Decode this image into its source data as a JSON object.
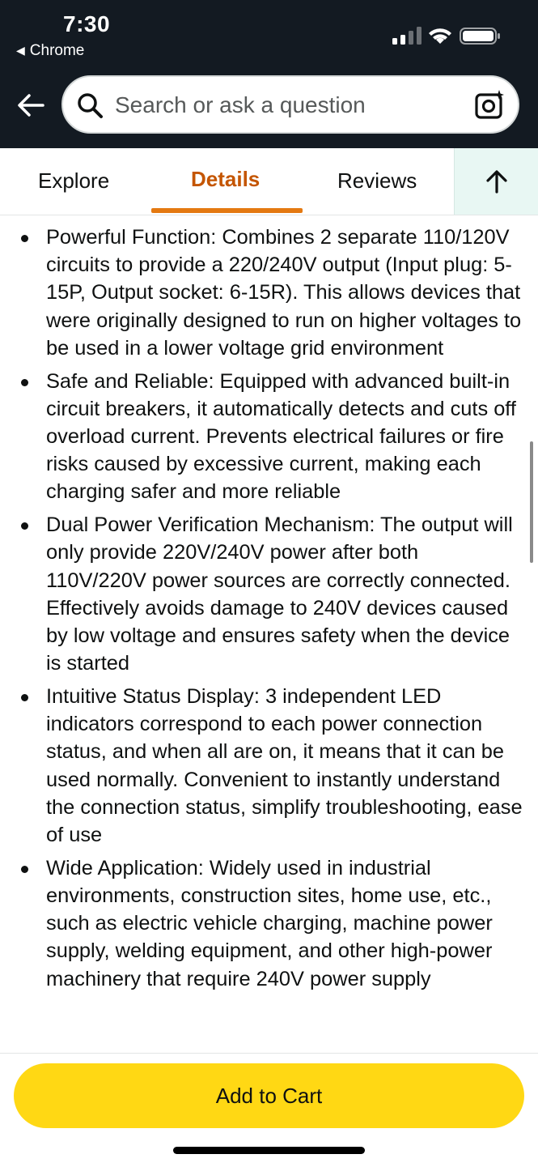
{
  "status_bar": {
    "time": "7:30",
    "back_app": "Chrome",
    "back_app_icon": "triangle-left-icon"
  },
  "header": {
    "back_icon": "arrow-left-icon",
    "search": {
      "placeholder": "Search or ask a question",
      "icon": "search-icon",
      "camera_icon": "camera-lens-icon"
    }
  },
  "tabs": {
    "items": [
      {
        "label": "Explore",
        "active": false
      },
      {
        "label": "Details",
        "active": true
      },
      {
        "label": "Reviews",
        "active": false
      }
    ],
    "scroll_top_icon": "arrow-up-icon",
    "active_color": "#c45500"
  },
  "content": {
    "bullets": [
      "Powerful Function: Combines 2 separate 110/120V circuits to provide a 220/240V output (Input plug: 5-15P, Output socket: 6-15R). This allows devices that were originally designed to run on higher voltages to be used in a lower voltage grid environment",
      "Safe and Reliable: Equipped with advanced built-in circuit breakers, it automatically detects and cuts off overload current. Prevents electrical failures or fire risks caused by excessive current, making each charging safer and more reliable",
      "Dual Power Verification Mechanism: The output will only provide 220V/240V power after both 110V/220V power sources are correctly connected. Effectively avoids damage to 240V devices caused by low voltage and ensures safety when the device is started",
      "Intuitive Status Display: 3 independent LED indicators correspond to each power connection status, and when all are on, it means that it can be used normally. Convenient to instantly understand the connection status, simplify troubleshooting, ease of use",
      "Wide Application: Widely used in industrial environments, construction sites, home use, etc., such as electric vehicle charging, machine power supply, welding equipment, and other high-power machinery that require 240V power supply"
    ]
  },
  "footer": {
    "add_to_cart": "Add to Cart",
    "button_color": "#ffd814"
  }
}
